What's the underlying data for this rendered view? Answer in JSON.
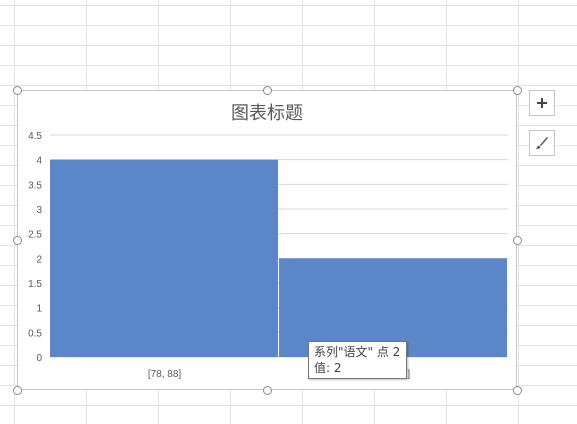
{
  "chart": {
    "title": "图表标题"
  },
  "chart_data": {
    "type": "bar",
    "title": "图表标题",
    "categories": [
      "[78, 88]",
      "[88, 98]"
    ],
    "series": [
      {
        "name": "语文",
        "values": [
          4,
          2
        ]
      }
    ],
    "ylim": [
      0,
      4.5
    ],
    "yticks": [
      "0",
      "0.5",
      "1",
      "1.5",
      "2",
      "2.5",
      "3",
      "3.5",
      "4",
      "4.5"
    ],
    "grid": true,
    "bar_color": "#5b87c8"
  },
  "tooltip": {
    "line1": "系列\"语文\" 点 2",
    "line2": "值: 2"
  },
  "side_buttons": {
    "add_icon": "plus-icon",
    "style_icon": "brush-icon"
  }
}
